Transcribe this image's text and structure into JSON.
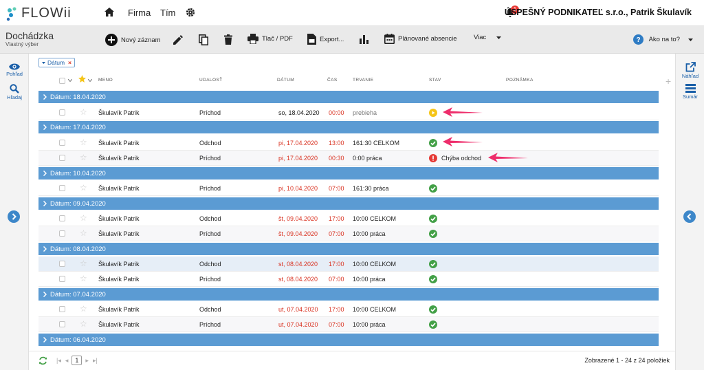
{
  "app": {
    "name": "FLOWii"
  },
  "nav": {
    "items": [
      "Firma",
      "Tím"
    ],
    "notifications": "1",
    "company": "ÚSPEŠNÝ PODNIKATEĽ s.r.o., Patrik Škulavík"
  },
  "page": {
    "title": "Dochádzka",
    "subtitle": "Vlastný výber"
  },
  "toolbar": {
    "new_record": "Nový záznam",
    "print": "Tlač / PDF",
    "export": "Export...",
    "planned": "Plánované absencie",
    "more": "Viac",
    "help": "Ako na to?"
  },
  "sidebar_left": {
    "view": "Pohľad",
    "search": "Hľadaj"
  },
  "sidebar_right": {
    "preview": "Náhľad",
    "summary": "Sumár"
  },
  "filter_chip": {
    "label": "Dátum",
    "remove": "×"
  },
  "columns": {
    "name": "MENO",
    "event": "UDALOSŤ",
    "date": "DÁTUM",
    "time": "ČAS",
    "duration": "TRVANIE",
    "status": "STAV",
    "note": "POZNÁMKA"
  },
  "groups": [
    "Dátum: 18.04.2020",
    "Dátum: 17.04.2020",
    "Dátum: 10.04.2020",
    "Dátum: 09.04.2020",
    "Dátum: 08.04.2020",
    "Dátum: 07.04.2020",
    "Dátum: 06.04.2020"
  ],
  "rows": [
    {
      "name": "Škulavík Patrik",
      "event": "Príchod",
      "date": "so, 18.04.2020",
      "time": "00:00",
      "duration": "prebieha",
      "status": "running",
      "note": ""
    },
    {
      "name": "Škulavík Patrik",
      "event": "Odchod",
      "date": "pi, 17.04.2020",
      "time": "13:00",
      "duration": "161:30 CELKOM",
      "status": "ok",
      "note": ""
    },
    {
      "name": "Škulavík Patrik",
      "event": "Príchod",
      "date": "pi, 17.04.2020",
      "time": "00:30",
      "duration": "0:00 práca",
      "status": "error",
      "note": "Chýba odchod"
    },
    {
      "name": "Škulavík Patrik",
      "event": "Príchod",
      "date": "pi, 10.04.2020",
      "time": "07:00",
      "duration": "161:30 práca",
      "status": "ok",
      "note": ""
    },
    {
      "name": "Škulavík Patrik",
      "event": "Odchod",
      "date": "št, 09.04.2020",
      "time": "17:00",
      "duration": "10:00 CELKOM",
      "status": "ok",
      "note": ""
    },
    {
      "name": "Škulavík Patrik",
      "event": "Príchod",
      "date": "št, 09.04.2020",
      "time": "07:00",
      "duration": "10:00 práca",
      "status": "ok",
      "note": ""
    },
    {
      "name": "Škulavík Patrik",
      "event": "Odchod",
      "date": "st, 08.04.2020",
      "time": "17:00",
      "duration": "10:00 CELKOM",
      "status": "ok",
      "note": ""
    },
    {
      "name": "Škulavík Patrik",
      "event": "Príchod",
      "date": "st, 08.04.2020",
      "time": "07:00",
      "duration": "10:00 práca",
      "status": "ok",
      "note": ""
    },
    {
      "name": "Škulavík Patrik",
      "event": "Odchod",
      "date": "ut, 07.04.2020",
      "time": "17:00",
      "duration": "10:00 CELKOM",
      "status": "ok",
      "note": ""
    },
    {
      "name": "Škulavík Patrik",
      "event": "Príchod",
      "date": "ut, 07.04.2020",
      "time": "07:00",
      "duration": "10:00 práca",
      "status": "ok",
      "note": ""
    }
  ],
  "footer": {
    "page": "1",
    "info": "Zobrazené 1 - 24 z 24 položiek"
  },
  "colors": {
    "accent": "#5b9bd3",
    "ok": "#43a047",
    "error": "#e53935",
    "running": "#f5c518",
    "annotation_arrow": "#ee2d6b",
    "date_red": "#d9301f"
  }
}
